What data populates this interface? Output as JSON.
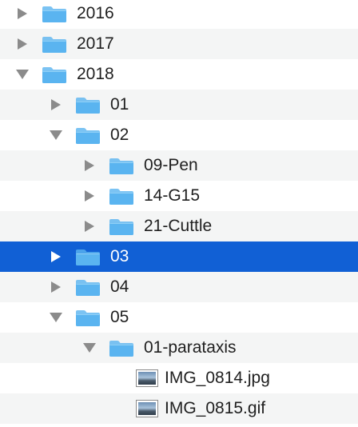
{
  "colors": {
    "selection": "#1160d5",
    "stripe": "#f4f5f5",
    "folder": "#5ab4f0",
    "disclosure": "#8b8b8b"
  },
  "tree": {
    "rows": [
      {
        "label": "2016",
        "level": 0,
        "kind": "folder",
        "expanded": false,
        "selected": false
      },
      {
        "label": "2017",
        "level": 0,
        "kind": "folder",
        "expanded": false,
        "selected": false
      },
      {
        "label": "2018",
        "level": 0,
        "kind": "folder",
        "expanded": true,
        "selected": false
      },
      {
        "label": "01",
        "level": 1,
        "kind": "folder",
        "expanded": false,
        "selected": false
      },
      {
        "label": "02",
        "level": 1,
        "kind": "folder",
        "expanded": true,
        "selected": false
      },
      {
        "label": "09-Pen",
        "level": 2,
        "kind": "folder",
        "expanded": false,
        "selected": false
      },
      {
        "label": "14-G15",
        "level": 2,
        "kind": "folder",
        "expanded": false,
        "selected": false
      },
      {
        "label": "21-Cuttle",
        "level": 2,
        "kind": "folder",
        "expanded": false,
        "selected": false
      },
      {
        "label": "03",
        "level": 1,
        "kind": "folder",
        "expanded": false,
        "selected": true
      },
      {
        "label": "04",
        "level": 1,
        "kind": "folder",
        "expanded": false,
        "selected": false
      },
      {
        "label": "05",
        "level": 1,
        "kind": "folder",
        "expanded": true,
        "selected": false
      },
      {
        "label": "01-parataxis",
        "level": 2,
        "kind": "folder",
        "expanded": true,
        "selected": false
      },
      {
        "label": "IMG_0814.jpg",
        "level": 3,
        "kind": "image-file",
        "icon": "image-file-icon",
        "selected": false
      },
      {
        "label": "IMG_0815.gif",
        "level": 3,
        "kind": "image-file",
        "icon": "image-file-icon",
        "selected": false
      }
    ]
  }
}
